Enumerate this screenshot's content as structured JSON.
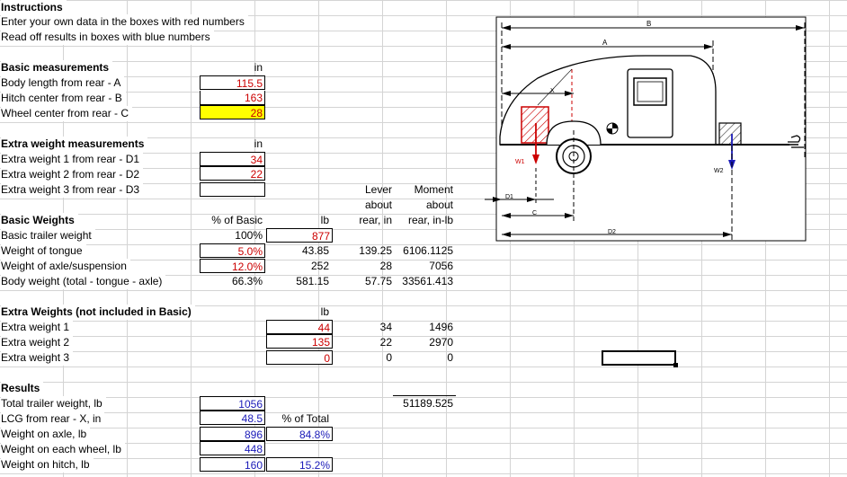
{
  "instructions": {
    "title": "Instructions",
    "line1": "Enter your own data in the boxes with red numbers",
    "line2": "Read off results in boxes with blue numbers"
  },
  "basic_measurements": {
    "title": "Basic measurements",
    "unit": "in",
    "rows": [
      {
        "label": "Body length from rear - A",
        "value": "115.5"
      },
      {
        "label": "Hitch center from rear - B",
        "value": "163"
      },
      {
        "label": "Wheel center from rear - C",
        "value": "28"
      }
    ]
  },
  "extra_measurements": {
    "title": "Extra weight measurements",
    "unit": "in",
    "rows": [
      {
        "label": "Extra weight 1 from rear - D1",
        "value": "34"
      },
      {
        "label": "Extra weight 2 from rear - D2",
        "value": "22"
      },
      {
        "label": "Extra weight 3 from rear - D3",
        "value": ""
      }
    ]
  },
  "headers": {
    "lever_1": "Lever",
    "lever_2": "about",
    "lever_3": "rear, in",
    "moment_1": "Moment",
    "moment_2": "about",
    "moment_3": "rear, in-lb",
    "pct_basic": "% of Basic",
    "lb": "lb",
    "lb2": "lb",
    "pct_total": "% of Total"
  },
  "basic_weights": {
    "title": "Basic Weights",
    "rows": [
      {
        "label": "Basic trailer weight",
        "pct": "100%",
        "lb": "877",
        "lever": "",
        "moment": ""
      },
      {
        "label": "Weight of tongue",
        "pct": "5.0%",
        "lb": "43.85",
        "lever": "139.25",
        "moment": "6106.1125"
      },
      {
        "label": "Weight of axle/suspension",
        "pct": "12.0%",
        "lb": "252",
        "lever": "28",
        "moment": "7056"
      },
      {
        "label": "Body weight (total - tongue - axle)",
        "pct": "66.3%",
        "lb": "581.15",
        "lever": "57.75",
        "moment": "33561.413"
      }
    ]
  },
  "extra_weights": {
    "title": "Extra Weights (not included in Basic)",
    "rows": [
      {
        "label": "Extra weight 1",
        "lb": "44",
        "lever": "34",
        "moment": "1496"
      },
      {
        "label": "Extra weight 2",
        "lb": "135",
        "lever": "22",
        "moment": "2970"
      },
      {
        "label": "Extra weight 3",
        "lb": "0",
        "lever": "0",
        "moment": "0"
      }
    ]
  },
  "results": {
    "title": "Results",
    "rows": [
      {
        "label": "Total trailer weight, lb",
        "value": "1056"
      },
      {
        "label": "LCG from rear - X, in",
        "value": "48.5"
      },
      {
        "label": "Weight on axle, lb",
        "value": "896",
        "pct": "84.8%"
      },
      {
        "label": "Weight on each wheel, lb",
        "value": "448"
      },
      {
        "label": "Weight on hitch, lb",
        "value": "160",
        "pct": "15.2%"
      }
    ],
    "moment_total": "51189.525"
  },
  "diagram": {
    "label_a": "A",
    "label_b": "B",
    "label_c": "C",
    "label_x": "X",
    "label_d1": "D1",
    "label_d2": "D2",
    "label_w1": "W1",
    "label_w2": "W2"
  },
  "colors": {
    "input_red": "#cc0000",
    "output_blue": "#1a1ab8",
    "highlight_yellow": "#ffff00"
  }
}
